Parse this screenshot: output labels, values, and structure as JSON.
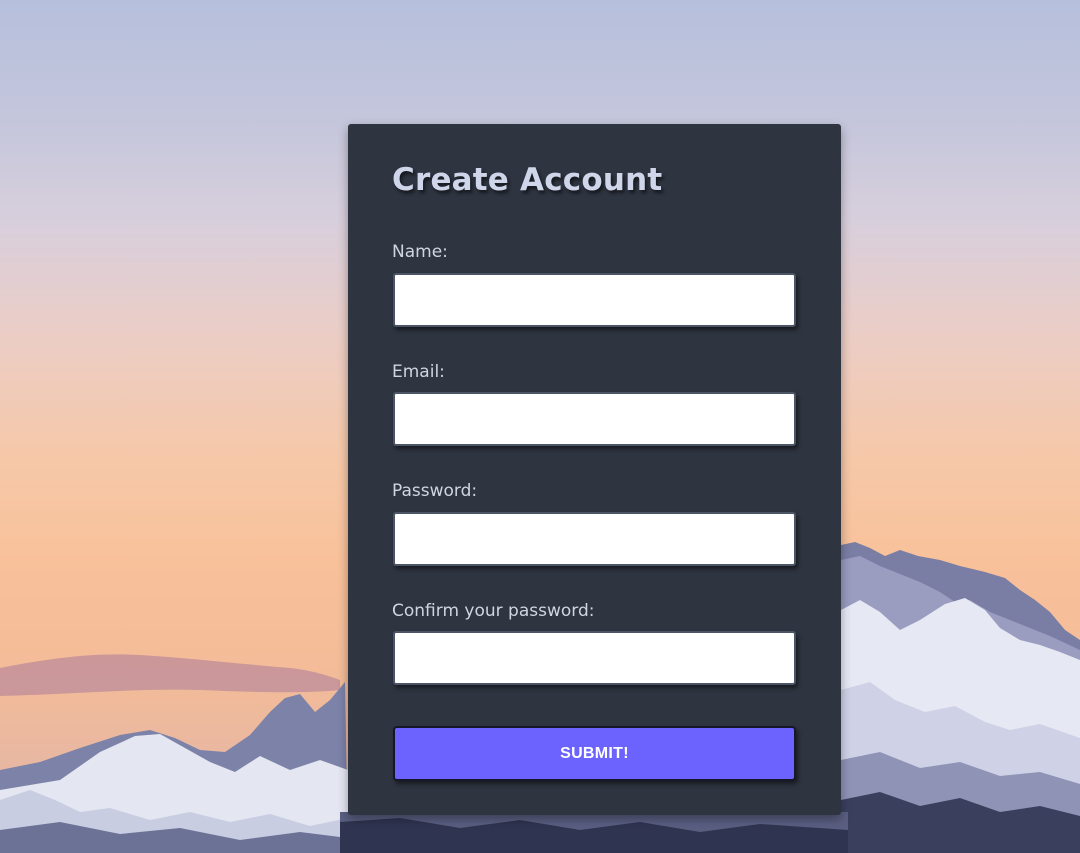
{
  "form": {
    "title": "Create Account",
    "fields": [
      {
        "label": "Name:",
        "value": "",
        "type": "text"
      },
      {
        "label": "Email:",
        "value": "",
        "type": "email"
      },
      {
        "label": "Password:",
        "value": "",
        "type": "password"
      },
      {
        "label": "Confirm your password:",
        "value": "",
        "type": "password"
      }
    ],
    "submit_label": "SUBMIT!"
  },
  "colors": {
    "card_background": "#2e3440",
    "title": "#cfd6ea",
    "label": "#d0d5e0",
    "submit_background": "#6c63ff",
    "submit_text": "#ffffff"
  }
}
